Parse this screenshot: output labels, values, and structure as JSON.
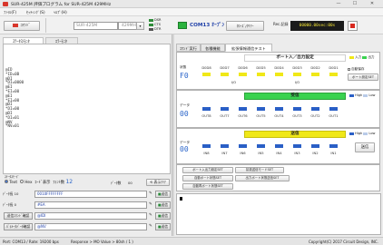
{
  "window": {
    "title": "SUR-425M 評価プログラム for SUR-425M 429MHz",
    "min": "—",
    "max": "☐",
    "close": "✕"
  },
  "menu": [
    "ﾌｧｲﾙ(F)",
    "ｾｯﾃｨﾝｸﾞ(S)",
    "ﾍﾙﾌﾟ(H)"
  ],
  "toolbar": {
    "send_btn": "ｺﾏﾝﾄﾞ",
    "device_combo": "SUR-425M",
    "freq_combo": "429MHz",
    "dsr": "DSR",
    "cts": "CTS",
    "dtr": "DTR",
    "port": "COM13 ｵｰﾌﾟﾝ",
    "close_btn": "ｸﾛｰｽﾞ/ｸﾘｱｰ",
    "time_label": "Rec.記録",
    "time_value": "00000.00sec:00s"
  },
  "left": {
    "tab1": "ｽﾃｰﾀｽ/ﾓﾆﾀ",
    "tab2": "ｴﾗｰﾓﾆﾀ",
    "log": [
      "@ID",
      "*ID=0B",
      "@DI",
      "*DI=0000",
      "@EI",
      "*EI=00",
      "@EI",
      "*EI=00",
      "@DI",
      "*DI=00",
      "@DI",
      "*DI=01",
      "@NV",
      "*NV=01"
    ],
    "display_mode": "ｽﾃｰﾀｽﾓｰﾄﾞ",
    "radio_text": "Text",
    "radio_hex": "Hex",
    "code_label": "ｺｰﾄﾞ表示",
    "font_label": "ﾌｫﾝﾄ数",
    "font_value": "12",
    "data_count_label": "ﾃﾞｰﾀ数",
    "data_count": "00",
    "clear_btn": "表示ｸﾘｱ",
    "rows": [
      {
        "label": "ﾃﾞｰﾀ長 10",
        "value": "0010FFFFFFFF",
        "btn": "送信"
      },
      {
        "label": "ﾃﾞｰﾀ長 0",
        "value": "#EA",
        "btn": "送信"
      },
      {
        "label": "送信ｺﾏﾝﾄﾞ確認",
        "value": "@IDI",
        "btn": "送信"
      },
      {
        "label": "ﾊﾟﾗﾒｰﾀﾃﾞｰﾀ確認",
        "value": "@NV",
        "btn": "送信"
      }
    ]
  },
  "right": {
    "tabs": [
      "ｺﾏﾝﾄﾞ実行",
      "各種機能",
      "拡張情報通信テスト"
    ],
    "port_panel": {
      "header": "ポート入／出力設定",
      "legend_in": "入力",
      "legend_out": "出力",
      "row_label": "状態",
      "value": "F0",
      "bits": [
        "D0D8",
        "D0D7",
        "D0D6",
        "D0D5",
        "D0D4",
        "D0D3",
        "D0D2",
        "D0D1"
      ],
      "io_labels": [
        "I/O",
        "I/O"
      ],
      "auto_label": "自動保存",
      "set_btn": "ポート設定SET"
    },
    "recv_panel": {
      "header": "受信",
      "row_label": "データ",
      "value": "00",
      "legend_high": "High",
      "legend_low": "Low",
      "bits": [
        "OUT8",
        "OUT7",
        "OUT6",
        "OUT5",
        "OUT4",
        "OUT3",
        "OUT2",
        "OUT1"
      ]
    },
    "send_panel": {
      "header": "送信",
      "row_label": "データ",
      "value": "00",
      "legend_high": "High",
      "legend_low": "Low",
      "bits": [
        "IN8",
        "IN7",
        "IN6",
        "IN5",
        "IN4",
        "IN3",
        "IN2",
        "IN1"
      ],
      "send_btn": "送信"
    },
    "action_btns": [
      "ポート入出力設定SET",
      "拡張送信モードSET",
      "自動ポート状態SET",
      "出力ポート状態送信SET",
      "自動再ポート状態SET"
    ],
    "colors": {
      "green": "#39d24f",
      "yellow": "#f0e817",
      "blue": "#2a5fc6",
      "lightblue": "#b9cbe8"
    }
  },
  "status": {
    "left": "Port: COM13 / Rate: 19200 bps",
    "mid": "Response > MO    Value > 80sh / 1 )",
    "right": "Copyright(C) 2017 Circuit Design, INC."
  }
}
